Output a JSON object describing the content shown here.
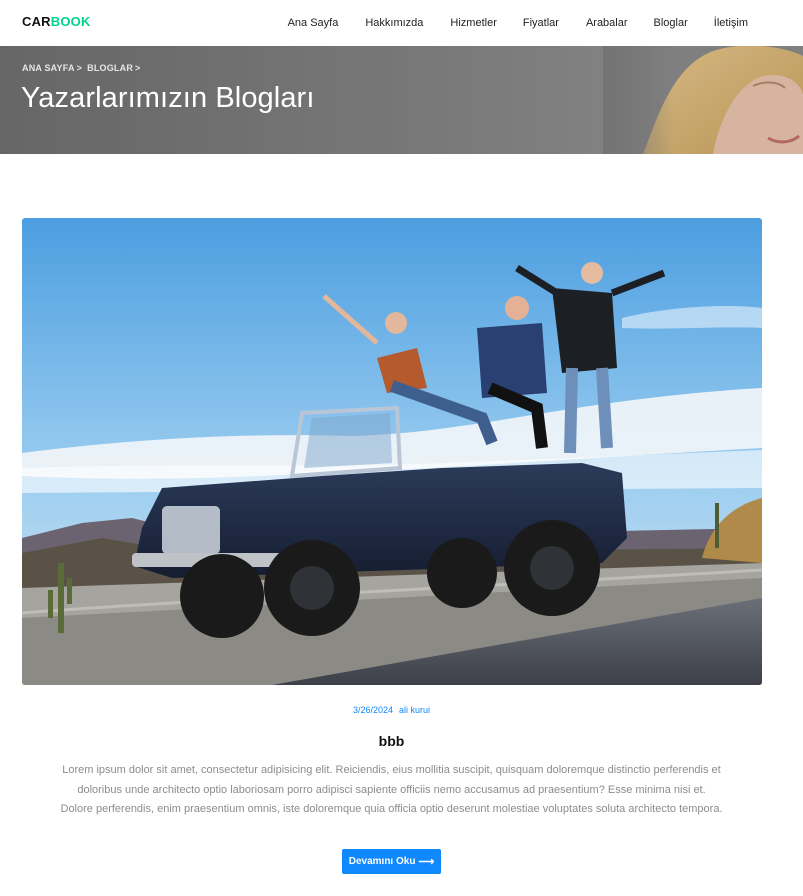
{
  "brand": {
    "part1": "CAR",
    "part2": "BOOK",
    "color_accent": "#01d28e"
  },
  "nav": {
    "items": [
      {
        "label": "Ana Sayfa"
      },
      {
        "label": "Hakkımızda"
      },
      {
        "label": "Hizmetler"
      },
      {
        "label": "Fiyatlar"
      },
      {
        "label": "Arabalar"
      },
      {
        "label": "Bloglar"
      },
      {
        "label": "İletişim"
      }
    ]
  },
  "hero": {
    "breadcrumb": [
      {
        "label": "ANA SAYFA",
        "sep": ">"
      },
      {
        "label": "BLOGLAR",
        "sep": ">"
      }
    ],
    "title": "Yazarlarımızın Blogları"
  },
  "post": {
    "date": "3/26/2024",
    "author": "ali kurui",
    "title": "bbb",
    "excerpt": "Lorem ipsum dolor sit amet, consectetur adipisicing elit. Reiciendis, eius mollitia suscipit, quisquam doloremque distinctio perferendis et doloribus unde architecto optio laboriosam porro adipisci sapiente officiis nemo accusamus ad praesentium? Esse minima nisi et. Dolore perferendis, enim praesentium omnis, iste doloremque quia officia optio deserunt molestiae voluptates soluta architecto tempora.",
    "read_more_label": "Devamını Oku",
    "read_more_icon": "arrow-right-icon"
  },
  "colors": {
    "primary": "#1089ff",
    "text_muted": "#8c8c8c"
  }
}
